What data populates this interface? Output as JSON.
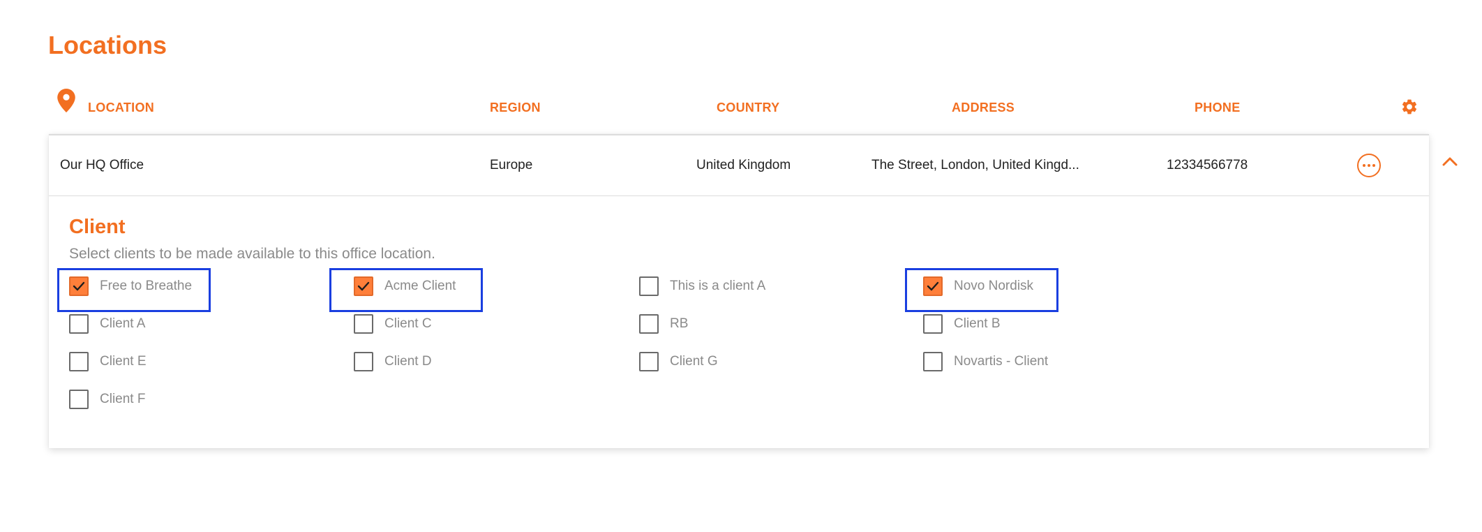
{
  "page": {
    "title": "Locations"
  },
  "table": {
    "headers": {
      "location": "LOCATION",
      "region": "REGION",
      "country": "COUNTRY",
      "address": "ADDRESS",
      "phone": "PHONE"
    },
    "row": {
      "location": "Our HQ Office",
      "region": "Europe",
      "country": "United Kingdom",
      "address": "The Street, London, United Kingd...",
      "phone": "12334566778"
    }
  },
  "client_section": {
    "title": "Client",
    "description": "Select clients to be made available to this office location.",
    "clients": [
      {
        "label": "Free to Breathe",
        "checked": true
      },
      {
        "label": "Acme Client",
        "checked": true
      },
      {
        "label": "This is a client A",
        "checked": false
      },
      {
        "label": "Novo Nordisk",
        "checked": true
      },
      {
        "label": "Client A",
        "checked": false
      },
      {
        "label": "Client C",
        "checked": false
      },
      {
        "label": "RB",
        "checked": false
      },
      {
        "label": "Client B",
        "checked": false
      },
      {
        "label": "Client E",
        "checked": false
      },
      {
        "label": "Client D",
        "checked": false
      },
      {
        "label": "Client G",
        "checked": false
      },
      {
        "label": "Novartis - Client",
        "checked": false
      },
      {
        "label": "Client F",
        "checked": false
      }
    ]
  },
  "icons": {
    "header": "location-pin-icon",
    "settings": "gear-icon",
    "row_actions": "more-horizontal-icon",
    "collapse": "chevron-up-icon",
    "check": "checkmark-icon"
  },
  "colors": {
    "accent": "#f26f21",
    "checkbox_checked": "#ff7f3a",
    "highlight": "#1a3fe0"
  }
}
